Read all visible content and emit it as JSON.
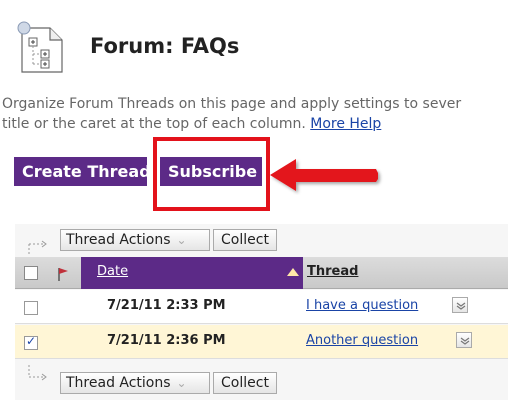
{
  "page": {
    "title": "Forum: FAQs",
    "description": "Organize Forum Threads on this page and apply settings to several at once. Click a title or the caret at the top of each column.",
    "description_line1": "Organize Forum Threads on this page and apply settings to sever",
    "description_line2": "title or the caret at the top of each column.",
    "more_help_label": "More Help"
  },
  "toolbar": {
    "create_thread_label": "Create Thread",
    "subscribe_label": "Subscribe"
  },
  "grid": {
    "actions_top": {
      "thread_actions_label": "Thread Actions",
      "collect_label": "Collect"
    },
    "actions_bottom": {
      "thread_actions_label": "Thread Actions",
      "collect_label": "Collect"
    },
    "columns": {
      "date": "Date",
      "thread": "Thread"
    },
    "rows": [
      {
        "date": "7/21/11 2:33 PM",
        "thread": "I have a question",
        "checked": false
      },
      {
        "date": "7/21/11 2:36 PM",
        "thread": "Another question",
        "checked": true
      }
    ]
  },
  "colors": {
    "accent": "#5c2a87",
    "highlight": "#e3121b",
    "link": "#1a44a6",
    "selected_row": "#fff6d6"
  }
}
